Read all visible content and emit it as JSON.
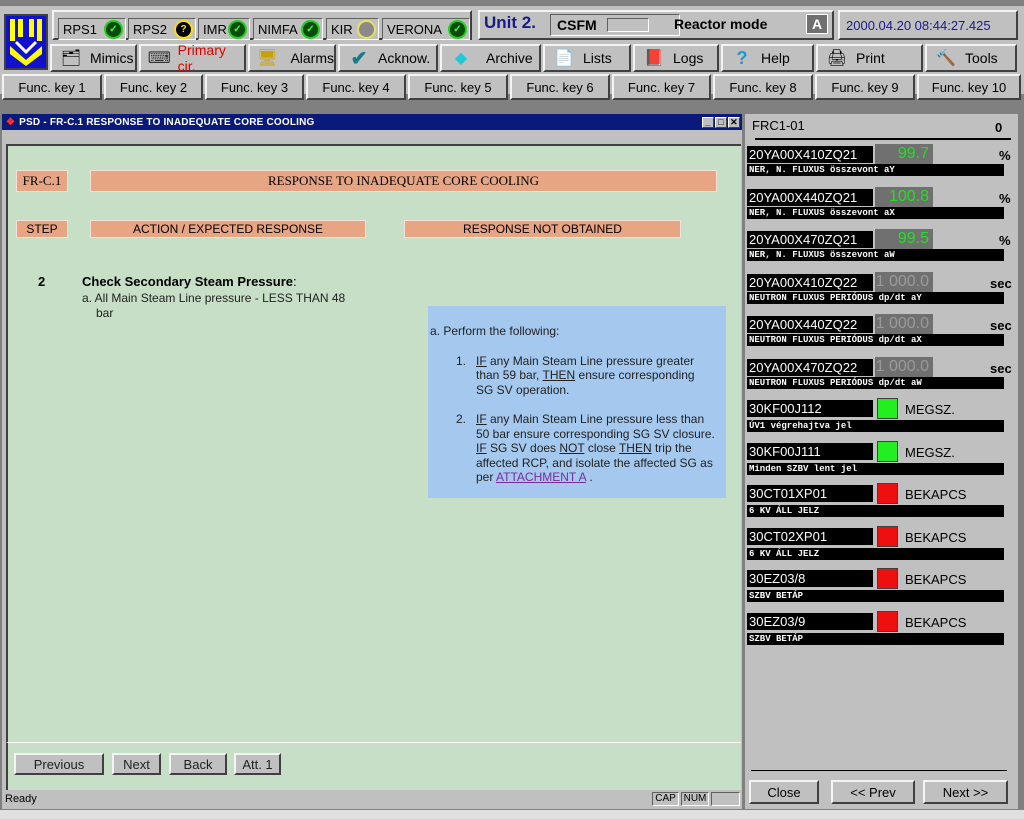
{
  "status_bar_top": {
    "systems": [
      {
        "name": "RPS1",
        "state": "ok",
        "icon": "check-icon"
      },
      {
        "name": "RPS2",
        "state": "unknown",
        "icon": "question-icon"
      },
      {
        "name": "IMR",
        "state": "ok",
        "icon": "check-icon"
      },
      {
        "name": "NIMFA",
        "state": "ok",
        "icon": "check-icon"
      },
      {
        "name": "KIR",
        "state": "inactive",
        "icon": "circle-icon"
      },
      {
        "name": "VERONA",
        "state": "ok",
        "icon": "check-icon"
      }
    ],
    "unit": "Unit 2.",
    "csfm_label": "CSFM",
    "reactor_mode_label": "Reactor mode",
    "reactor_mode_value": "A",
    "datetime": "2000.04.20 08:44:27.425"
  },
  "toolbar": {
    "buttons": [
      {
        "label": "Mimics",
        "icon": "mimics-icon"
      },
      {
        "label": "Primary cir.",
        "icon": "keyboard-icon",
        "color": "#e00000"
      },
      {
        "label": "Alarms",
        "icon": "alarms-icon"
      },
      {
        "label": "Acknow.",
        "icon": "checkmark-icon"
      },
      {
        "label": "Archive",
        "icon": "diamond-icon"
      },
      {
        "label": "Lists",
        "icon": "documents-icon"
      },
      {
        "label": "Logs",
        "icon": "book-icon"
      },
      {
        "label": "Help",
        "icon": "question-mark-icon"
      },
      {
        "label": "Print",
        "icon": "printer-icon"
      },
      {
        "label": "Tools",
        "icon": "hammer-icon"
      }
    ]
  },
  "function_keys": [
    "Func. key 1",
    "Func. key 2",
    "Func. key 3",
    "Func. key 4",
    "Func. key 5",
    "Func. key 6",
    "Func. key 7",
    "Func. key 8",
    "Func. key 9",
    "Func. key 10"
  ],
  "procedure_window": {
    "title": "PSD - FR-C.1 RESPONSE TO INADEQUATE CORE COOLING",
    "proc_id": "FR-C.1",
    "proc_title": "RESPONSE TO INADEQUATE CORE COOLING",
    "col_step": "STEP",
    "col_action": "ACTION / EXPECTED RESPONSE",
    "col_rno": "RESPONSE NOT OBTAINED",
    "step": {
      "number": "2",
      "title": "Check Secondary Steam Pressure",
      "title_suffix": ":",
      "sub_a": "a. All Main Steam Line pressure - LESS THAN 48",
      "sub_a_cont": "bar"
    },
    "rno": {
      "intro": "a. Perform the following:",
      "item1": {
        "num": "1.",
        "if": "IF",
        "t1": " any Main Steam Line pressure greater than 59 bar, ",
        "then": "THEN",
        "t2": " ensure corresponding SG SV operation."
      },
      "item2": {
        "num": "2.",
        "if": "IF",
        "t1": " any Main Steam Line pressure less than 50 bar ensure corresponding SG SV closure. ",
        "if2": "IF",
        "t2": " SG SV does ",
        "not": "NOT",
        "t3": " close ",
        "then": "THEN",
        "t4": " trip the affected RCP, and isolate the affected SG as per ",
        "link": "ATTACHMENT A",
        "t5": " ."
      }
    },
    "nav_buttons": [
      "Previous",
      "Next",
      "Back",
      "Att. 1"
    ],
    "status_text": "Ready",
    "indicators": [
      "CAP",
      "NUM",
      ""
    ]
  },
  "right_panel": {
    "title": "FRC1-01",
    "counter": "0",
    "analog": [
      {
        "tag": "20YA00X410ZQ21",
        "value": "99.7",
        "unit": "%",
        "desc": "NER, N. FLUXUS összevont aY",
        "color": "#22e022"
      },
      {
        "tag": "20YA00X440ZQ21",
        "value": "100.8",
        "unit": "%",
        "desc": "NER, N. FLUXUS összevont aX",
        "color": "#22e022"
      },
      {
        "tag": "20YA00X470ZQ21",
        "value": "99.5",
        "unit": "%",
        "desc": "NER, N. FLUXUS összevont aW",
        "color": "#22e022"
      },
      {
        "tag": "20YA00X410ZQ22",
        "value": "1 000.0",
        "unit": "sec",
        "desc": "NEUTRON FLUXUS PERIÓDUS dp/dt aY",
        "color": "#9a9a9a"
      },
      {
        "tag": "20YA00X440ZQ22",
        "value": "1 000.0",
        "unit": "sec",
        "desc": "NEUTRON FLUXUS PERIÓDUS dp/dt aX",
        "color": "#9a9a9a"
      },
      {
        "tag": "20YA00X470ZQ22",
        "value": "1 000.0",
        "unit": "sec",
        "desc": "NEUTRON FLUXUS PERIÓDUS dp/dt aW",
        "color": "#9a9a9a"
      }
    ],
    "binary": [
      {
        "tag": "30KF00J112",
        "state": "MEGSZ.",
        "desc": "ÚV1 végrehajtva jel",
        "color": "#22ee22"
      },
      {
        "tag": "30KF00J111",
        "state": "MEGSZ.",
        "desc": "Minden SZBV lent jel",
        "color": "#22ee22"
      },
      {
        "tag": "30CT01XP01",
        "state": "BEKAPCS",
        "desc": "6 KV ÁLL JELZ",
        "color": "#ee1010"
      },
      {
        "tag": "30CT02XP01",
        "state": "BEKAPCS",
        "desc": "6 KV ÁLL JELZ",
        "color": "#ee1010"
      },
      {
        "tag": "30EZ03/8",
        "state": "BEKAPCS",
        "desc": "SZBV BETÁP",
        "color": "#ee1010"
      },
      {
        "tag": "30EZ03/9",
        "state": "BEKAPCS",
        "desc": "SZBV BETÁP",
        "color": "#ee1010"
      }
    ],
    "buttons": [
      "Close",
      "<< Prev",
      "Next >>"
    ]
  }
}
